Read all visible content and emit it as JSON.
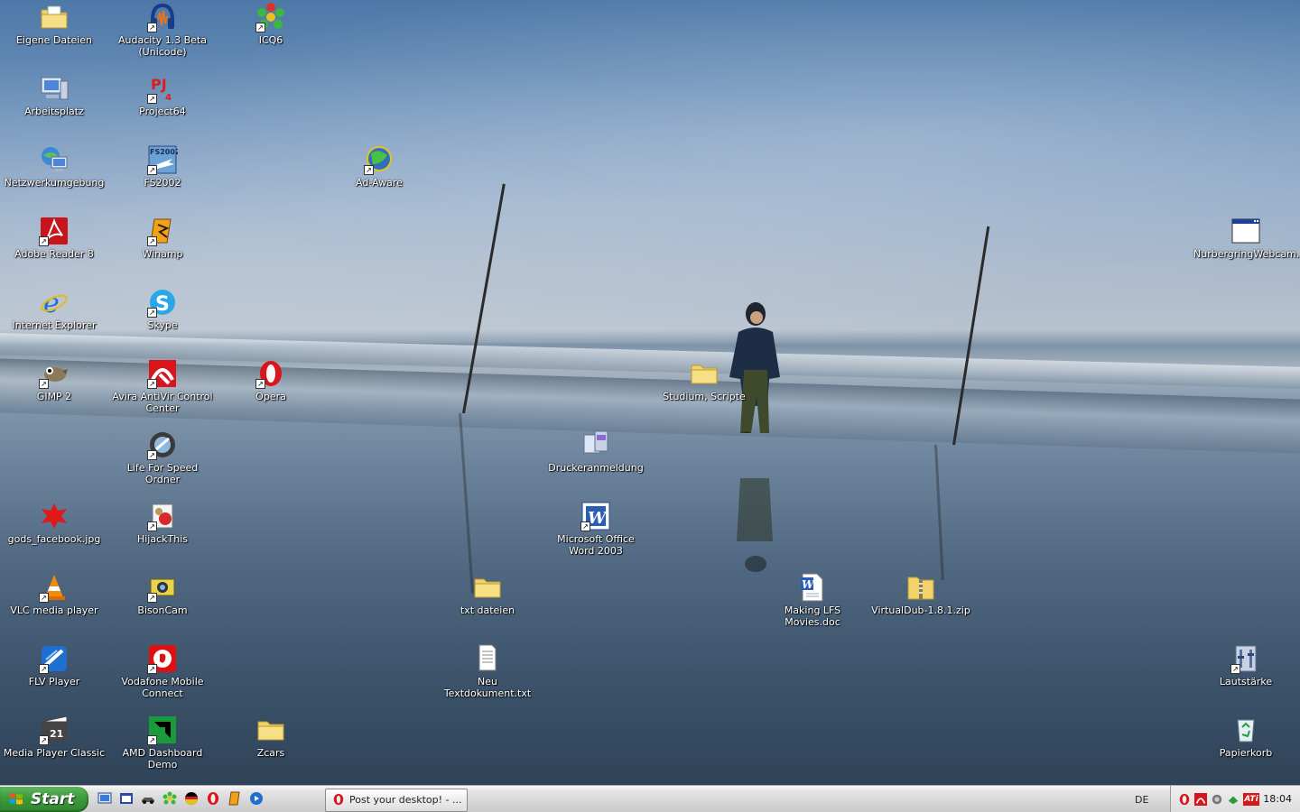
{
  "desktop": {
    "icons": [
      {
        "label": "Eigene Dateien",
        "icon": "folder-documents-icon"
      },
      {
        "label": "Audacity 1.3 Beta (Unicode)",
        "icon": "audacity-icon"
      },
      {
        "label": "ICQ6",
        "icon": "icq-flower-icon"
      },
      {
        "label": "Arbeitsplatz",
        "icon": "my-computer-icon"
      },
      {
        "label": "Project64",
        "icon": "project64-icon"
      },
      {
        "label": "Netzwerkumgebung",
        "icon": "network-icon"
      },
      {
        "label": "FS2002",
        "icon": "flight-simulator-icon"
      },
      {
        "label": "Ad-Aware",
        "icon": "ad-aware-icon"
      },
      {
        "label": "Adobe Reader 8",
        "icon": "adobe-reader-icon"
      },
      {
        "label": "Winamp",
        "icon": "winamp-icon"
      },
      {
        "label": "NurbergringWebcam....",
        "icon": "window-app-icon"
      },
      {
        "label": "Internet Explorer",
        "icon": "internet-explorer-icon"
      },
      {
        "label": "Skype",
        "icon": "skype-icon"
      },
      {
        "label": "GIMP 2",
        "icon": "gimp-icon"
      },
      {
        "label": "Avira AntiVir Control Center",
        "icon": "avira-umbrella-icon"
      },
      {
        "label": "Opera",
        "icon": "opera-icon"
      },
      {
        "label": "Studium, Scripte",
        "icon": "folder-icon"
      },
      {
        "label": "Life For Speed Ordner",
        "icon": "lfs-icon"
      },
      {
        "label": "Druckeranmeldung",
        "icon": "printer-login-icon"
      },
      {
        "label": "gods_facebook.jpg",
        "icon": "image-file-icon"
      },
      {
        "label": "HijackThis",
        "icon": "hijackthis-icon"
      },
      {
        "label": "Microsoft Office Word 2003",
        "icon": "word-icon"
      },
      {
        "label": "VLC media player",
        "icon": "vlc-cone-icon"
      },
      {
        "label": "BisonCam",
        "icon": "bisoncam-icon"
      },
      {
        "label": "txt dateien",
        "icon": "folder-icon"
      },
      {
        "label": "Making LFS Movies.doc",
        "icon": "word-document-icon"
      },
      {
        "label": "VirtualDub-1.8.1.zip",
        "icon": "zip-folder-icon"
      },
      {
        "label": "FLV Player",
        "icon": "flv-player-icon"
      },
      {
        "label": "Vodafone Mobile Connect",
        "icon": "vodafone-icon"
      },
      {
        "label": "Neu Textdokument.txt",
        "icon": "text-file-icon"
      },
      {
        "label": "Lautstärke",
        "icon": "volume-icon"
      },
      {
        "label": "Media Player Classic",
        "icon": "media-player-classic-icon"
      },
      {
        "label": "AMD Dashboard Demo",
        "icon": "amd-dashboard-icon"
      },
      {
        "label": "Zcars",
        "icon": "folder-icon"
      },
      {
        "label": "Papierkorb",
        "icon": "recycle-bin-icon"
      }
    ]
  },
  "taskbar": {
    "start_label": "Start",
    "quick_launch": [
      "show-desktop-icon",
      "app-window-icon",
      "racing-car-icon",
      "icq-icon",
      "germany-flag-icon",
      "opera-icon",
      "winamp-icon",
      "media-icon"
    ],
    "task_button_label": "Post your desktop! - ...",
    "language": "DE",
    "tray_icons": [
      "opera-tray-icon",
      "avira-tray-icon",
      "network-tray-icon",
      "security-tray-icon",
      "ati-tray-icon"
    ],
    "tray_ati_label": "ATi",
    "clock": "18:04"
  },
  "colors": {
    "start_green": "#3c9a3c",
    "label_text": "#ffffff"
  }
}
